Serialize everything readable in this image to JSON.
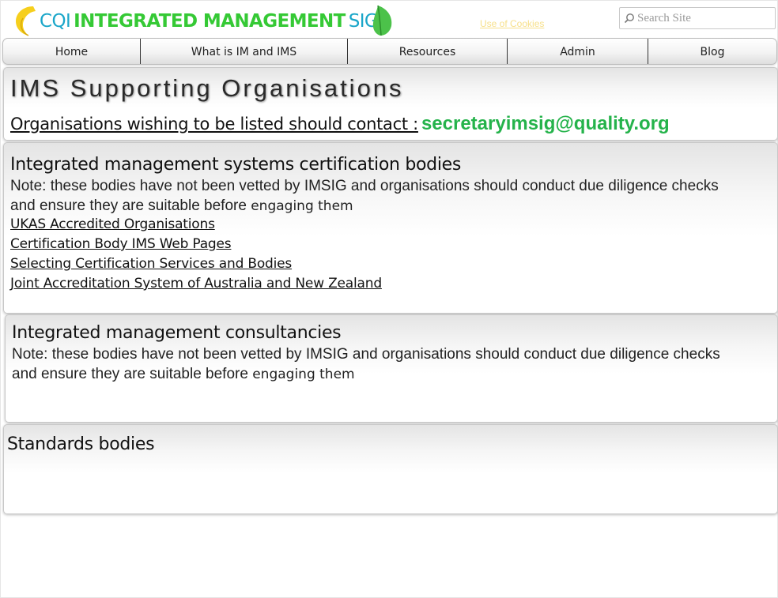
{
  "header": {
    "logo": {
      "cqi": "CQI",
      "main": "INTEGRATED MANAGEMENT",
      "sig": "SIG"
    },
    "cookies_link": "Use of Cookies",
    "search": {
      "placeholder": "Search Site"
    }
  },
  "nav": {
    "items": [
      {
        "label": "Home"
      },
      {
        "label": "What is IM and IMS"
      },
      {
        "label": "Resources"
      },
      {
        "label": "Admin"
      },
      {
        "label": "Blog"
      }
    ]
  },
  "intro": {
    "title": "IMS Supporting Organisations",
    "contact_label": "Organisations wishing to be listed should contact :",
    "contact_email": "secretaryimsig@quality.org"
  },
  "sections": [
    {
      "heading": "Integrated management systems certification bodies",
      "note": "Note: these bodies have not been vetted by IMSIG and organisations should conduct due diligence checks and ensure they are suitable before",
      "note_tail": "engaging them",
      "links": [
        {
          "label": "UKAS Accredited Organisations"
        },
        {
          "label": "Certification Body IMS Web Pages"
        },
        {
          "label": "Selecting Certification Services and Bodies"
        },
        {
          "label": "Joint Accreditation System of Australia and New Zealand"
        }
      ]
    },
    {
      "heading": "Integrated management consultancies",
      "note": "Note: these bodies have not been vetted by IMSIG and organisations should conduct due diligence checks and ensure they are suitable before",
      "note_tail": "engaging them"
    },
    {
      "heading": "Standards bodies"
    }
  ],
  "colors": {
    "logo_green": "#35c935",
    "logo_blue": "#1aa6c9",
    "email_green": "#25b34b",
    "cookies_yellow": "#f7e08a"
  }
}
